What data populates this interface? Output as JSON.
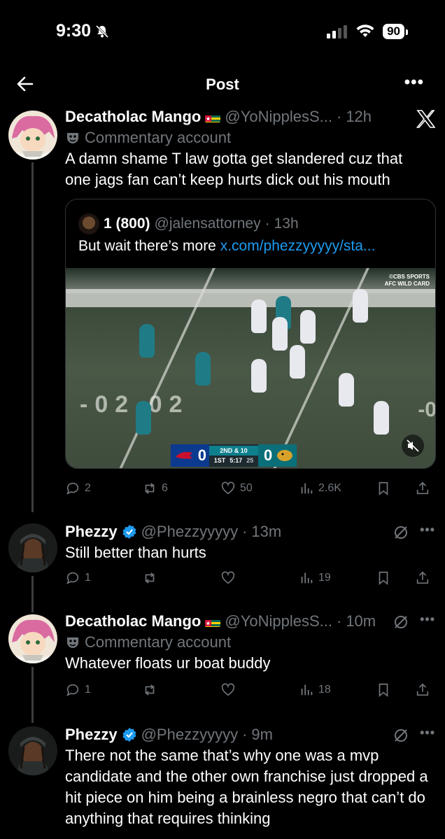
{
  "status_bar": {
    "time": "9:30",
    "battery": "90"
  },
  "header": {
    "title": "Post"
  },
  "main_post": {
    "name": "Decatholac Mango",
    "handle": "@YoNipplesS...",
    "time": "12h",
    "label": "Commentary account",
    "text": "A damn shame T law gotta get slandered cuz that one jags fan can’t keep hurts dick out his mouth",
    "quote": {
      "name": "1 (800)",
      "handle": "@jalensattorney",
      "time": "13h",
      "text": "But wait there’s more ",
      "link": "x.com/phezzyyyyy/sta...",
      "video": {
        "watermark": "©CBS SPORTS",
        "watermark_sub": "AFC WILD CARD",
        "home_score": "0",
        "away_score": "0",
        "down": "2ND & 10",
        "quarter": "1ST",
        "clock": "5:17",
        "play_clock": "25"
      }
    },
    "stats": {
      "replies": "2",
      "reposts": "6",
      "likes": "50",
      "views": "2.6K"
    }
  },
  "replies": [
    {
      "name": "Phezzy",
      "handle": "@Phezzyyyyy",
      "time": "13m",
      "text": "Still better than hurts",
      "stats": {
        "replies": "1",
        "views": "19"
      }
    },
    {
      "name": "Decatholac Mango",
      "handle": "@YoNipplesS...",
      "time": "10m",
      "label": "Commentary account",
      "text": "Whatever floats ur boat buddy",
      "stats": {
        "replies": "1",
        "views": "18"
      }
    },
    {
      "name": "Phezzy",
      "handle": "@Phezzyyyyy",
      "time": "9m",
      "text": "There not the same that’s why one was a mvp candidate and the other own franchise just dropped a hit piece on him being a brainless negro that can’t do anything that requires thinking"
    }
  ],
  "icons": [
    "back-arrow-icon",
    "more-icon",
    "x-logo-icon",
    "verified-icon",
    "grok-icon",
    "reply-icon",
    "repost-icon",
    "like-icon",
    "views-icon",
    "bookmark-icon",
    "share-icon",
    "mute-icon"
  ],
  "colors": {
    "background": "#000000",
    "text": "#e7e9ea",
    "muted": "#71767b",
    "link": "#1d9bf0",
    "border": "#2f3336"
  }
}
